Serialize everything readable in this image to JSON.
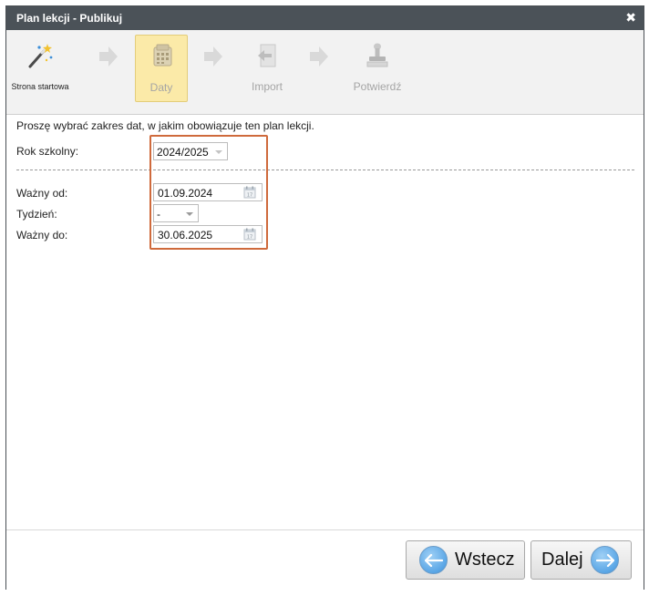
{
  "window": {
    "title": "Plan lekcji - Publikuj",
    "close_glyph": "✖"
  },
  "wizard": {
    "steps": [
      {
        "label": "Strona startowa",
        "icon": "magic-wand-icon",
        "state": "done"
      },
      {
        "label": "Daty",
        "icon": "calendar-icon",
        "state": "active"
      },
      {
        "label": "Import",
        "icon": "import-icon",
        "state": "inactive"
      },
      {
        "label": "Potwierdź",
        "icon": "stamp-icon",
        "state": "inactive"
      }
    ],
    "arrow_icon": "right-arrow-icon"
  },
  "form": {
    "intro": "Proszę wybrać zakres dat, w jakim obowiązuje ten plan lekcji.",
    "school_year": {
      "label": "Rok szkolny:",
      "value": "2024/2025"
    },
    "valid_from": {
      "label": "Ważny od:",
      "value": "01.09.2024"
    },
    "week": {
      "label": "Tydzień:",
      "value": "-"
    },
    "valid_to": {
      "label": "Ważny do:",
      "value": "30.06.2025"
    },
    "calendar_icon": "calendar-picker-icon"
  },
  "footer": {
    "back_label": "Wstecz",
    "next_label": "Dalej"
  },
  "colors": {
    "titlebar": "#4b5258",
    "active_step": "#fbeaa8",
    "highlight": "#cf6a3c",
    "button_icon": "#5aa6e6"
  }
}
